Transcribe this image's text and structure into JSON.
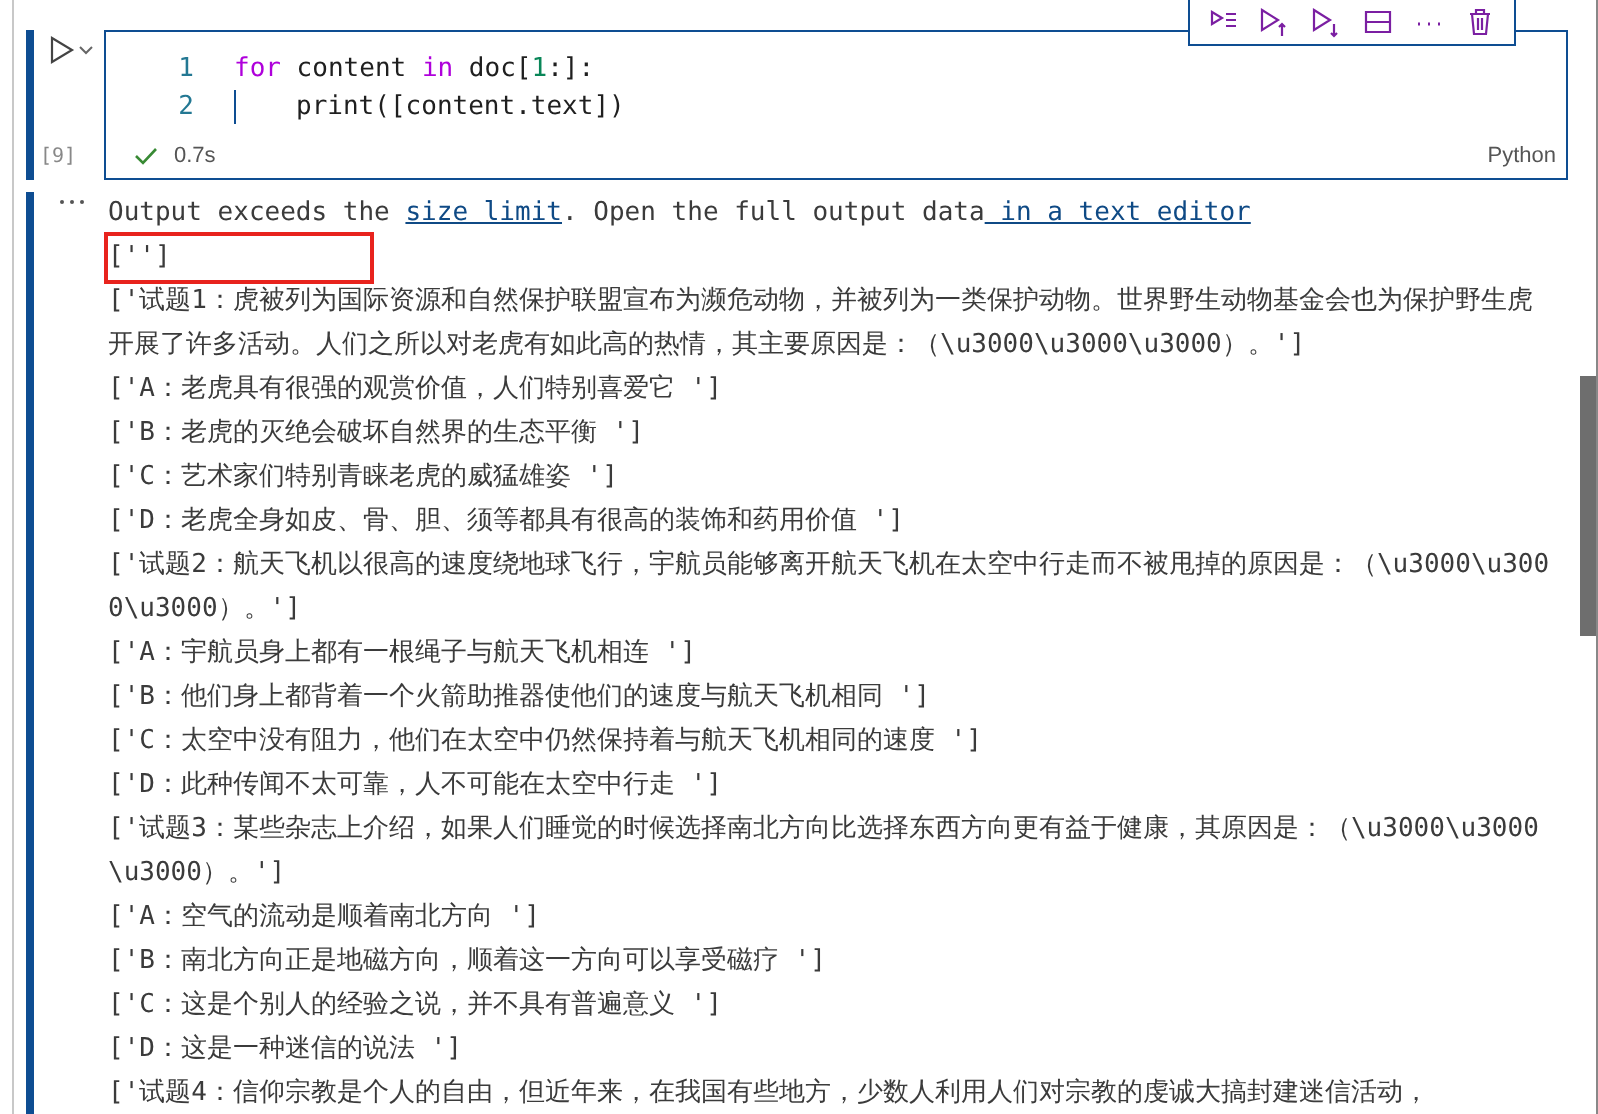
{
  "cell": {
    "selected": true,
    "execution_count": "[9]",
    "lines": [
      {
        "number": "1",
        "tokens": [
          {
            "kind": "keyword",
            "text": "for"
          },
          {
            "kind": "plain",
            "text": " content "
          },
          {
            "kind": "keyword",
            "text": "in"
          },
          {
            "kind": "plain",
            "text": " doc["
          },
          {
            "kind": "number",
            "text": "1"
          },
          {
            "kind": "plain",
            "text": ":]:"
          }
        ]
      },
      {
        "number": "2",
        "tokens": [
          {
            "kind": "indent"
          },
          {
            "kind": "plain",
            "text": "print([content.text])"
          }
        ]
      }
    ],
    "status": {
      "succeeded": true,
      "duration": "0.7s"
    },
    "language": "Python"
  },
  "output": {
    "notice": {
      "before": "Output exceeds the ",
      "link1": "size limit",
      "middle": ". Open the full output data",
      "link2": " in a text editor"
    },
    "lines": [
      {
        "text": "['']",
        "highlighted": true
      },
      {
        "text": "['试题1：虎被列为国际资源和自然保护联盟宣布为濒危动物，并被列为一类保护动物。世界野生动物基金会也为保护野生虎开展了许多活动。人们之所以对老虎有如此高的热情，其主要原因是：（\\u3000\\u3000\\u3000）。']",
        "highlighted": false
      },
      {
        "text": "['A：老虎具有很强的观赏价值，人们特别喜爱它 ']",
        "highlighted": false
      },
      {
        "text": "['B：老虎的灭绝会破坏自然界的生态平衡 ']",
        "highlighted": false
      },
      {
        "text": "['C：艺术家们特别青睐老虎的威猛雄姿 ']",
        "highlighted": false
      },
      {
        "text": "['D：老虎全身如皮、骨、胆、须等都具有很高的装饰和药用价值 ']",
        "highlighted": false
      },
      {
        "text": "['试题2：航天飞机以很高的速度绕地球飞行，宇航员能够离开航天飞机在太空中行走而不被甩掉的原因是：（\\u3000\\u3000\\u3000）。']",
        "highlighted": false
      },
      {
        "text": "['A：宇航员身上都有一根绳子与航天飞机相连 ']",
        "highlighted": false
      },
      {
        "text": "['B：他们身上都背着一个火箭助推器使他们的速度与航天飞机相同 ']",
        "highlighted": false
      },
      {
        "text": "['C：太空中没有阻力，他们在太空中仍然保持着与航天飞机相同的速度 ']",
        "highlighted": false
      },
      {
        "text": "['D：此种传闻不太可靠，人不可能在太空中行走 ']",
        "highlighted": false
      },
      {
        "text": "['试题3：某些杂志上介绍，如果人们睡觉的时候选择南北方向比选择东西方向更有益于健康，其原因是：（\\u3000\\u3000\\u3000）。']",
        "highlighted": false
      },
      {
        "text": "['A：空气的流动是顺着南北方向 ']",
        "highlighted": false
      },
      {
        "text": "['B：南北方向正是地磁方向，顺着这一方向可以享受磁疗 ']",
        "highlighted": false
      },
      {
        "text": "['C：这是个别人的经验之说，并不具有普遍意义 ']",
        "highlighted": false
      },
      {
        "text": "['D：这是一种迷信的说法 ']",
        "highlighted": false
      },
      {
        "text": "['试题4：信仰宗教是个人的自由，但近年来，在我国有些地方，少数人利用人们对宗教的虔诚大搞封建迷信活动，",
        "highlighted": false
      }
    ]
  }
}
